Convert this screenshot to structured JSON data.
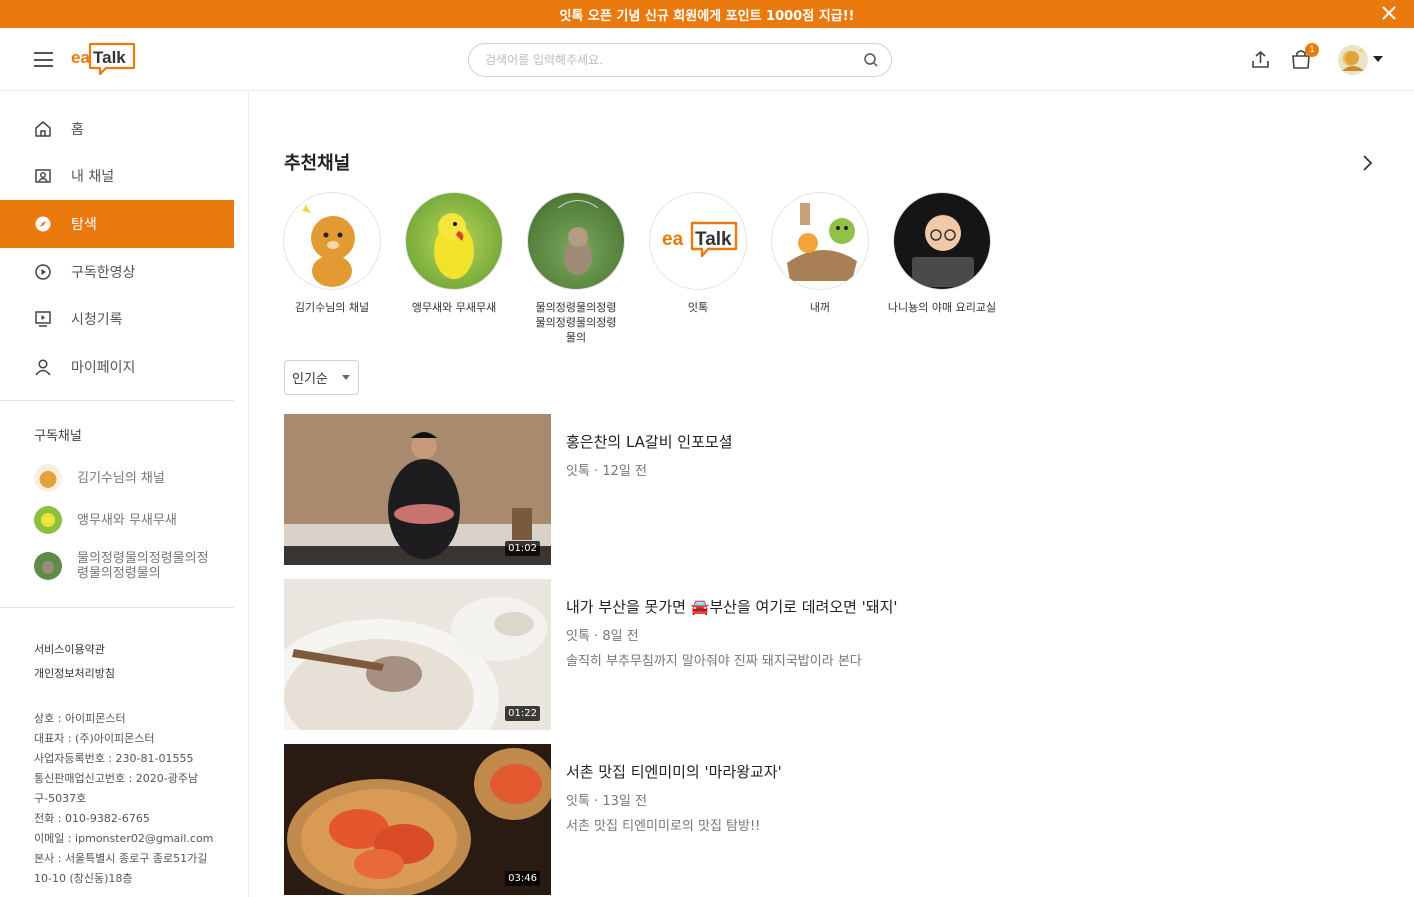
{
  "colors": {
    "accent": "#ea7a0e"
  },
  "banner": {
    "text": "잇톡 오픈 기념 신규 회원에게 포인트 1000점 지급!!",
    "close_icon": "close-icon"
  },
  "header": {
    "logo_text": "eaTalk",
    "search_placeholder": "검색어를 입력해주세요.",
    "cart_count": "1",
    "icons": [
      "menu-icon",
      "search-icon",
      "upload-icon",
      "cart-icon",
      "avatar",
      "chevron-down-icon"
    ]
  },
  "sidebar": {
    "nav": [
      {
        "label": "홈",
        "icon": "home-icon"
      },
      {
        "label": "내 채널",
        "icon": "channel-icon"
      },
      {
        "label": "탐색",
        "icon": "compass-icon",
        "active": true
      },
      {
        "label": "구독한영상",
        "icon": "play-circle-icon"
      },
      {
        "label": "시청기록",
        "icon": "history-icon"
      },
      {
        "label": "마이페이지",
        "icon": "user-icon"
      }
    ],
    "subscribed_title": "구독채널",
    "subscribed": [
      {
        "name": "김기수님의 채널"
      },
      {
        "name": "앵무새와 무새무새"
      },
      {
        "name": "물의정령물의정령물의정령물의정령물의"
      }
    ],
    "footer_links": [
      "서비스이용약관",
      "개인정보처리방침"
    ],
    "company_info": [
      "상호 : 아이피몬스터",
      "대표자 : (주)아이피몬스터",
      "사업자등록번호 : 230-81-01555",
      "통신판매업신고번호 : 2020-광주남구-5037호",
      "전화 : 010-9382-6765",
      "이메일 : ipmonster02@gmail.com",
      "본사 : 서울특별시 종로구 종로51가길 10-10 (창신동)18층"
    ]
  },
  "main": {
    "recommended_title": "추천채널",
    "channels": [
      {
        "name": "김기수님의 채널"
      },
      {
        "name": "앵무새와 무새무새"
      },
      {
        "name": "물의정령물의정령물의정령물의정령물의"
      },
      {
        "name": "잇톡"
      },
      {
        "name": "내꺼"
      },
      {
        "name": "나니뇽의 야매 요리교실"
      }
    ],
    "sort_label": "인기순",
    "videos": [
      {
        "title": "홍은찬의 LA갈비 인포모셜",
        "meta": "잇톡 · 12일 전",
        "desc": "",
        "duration": "01:02"
      },
      {
        "title": "내가 부산을 못가면 🚘부산을 여기로 데려오면 '돼지'",
        "meta": "잇톡 · 8일 전",
        "desc": "솔직히 부추무침까지 말아줘야 진짜 돼지국밥이라 본다",
        "duration": "01:22"
      },
      {
        "title": "서촌 맛집 티엔미미의 '마라왕교자'",
        "meta": "잇톡 · 13일 전",
        "desc": "서촌 맛집 티엔미미로의 맛집 탐방!!",
        "duration": "03:46"
      }
    ]
  }
}
